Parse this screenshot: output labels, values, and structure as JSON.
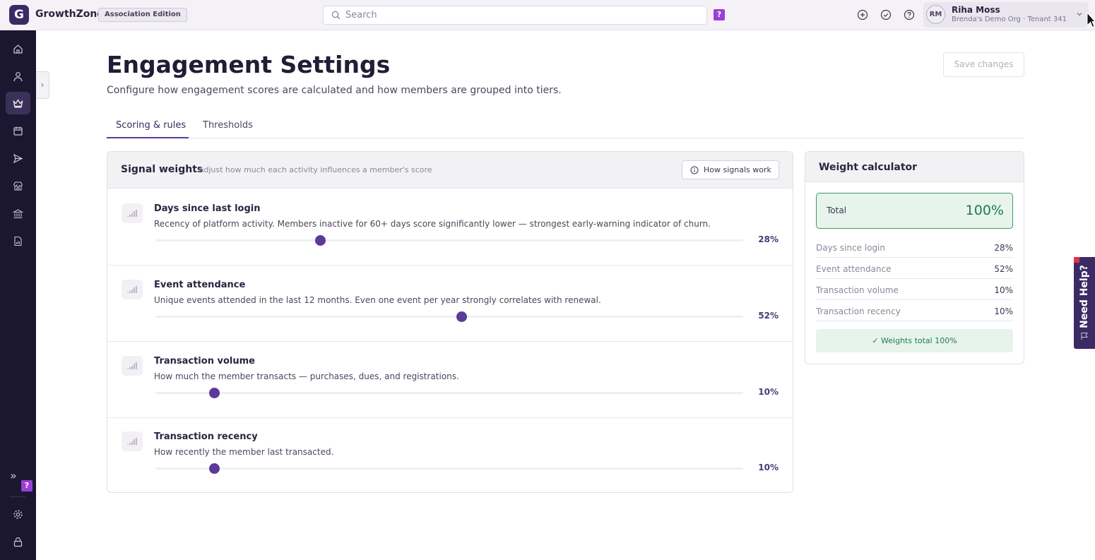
{
  "app": {
    "logo_letter": "G",
    "brand": "GrowthZone",
    "edition": "Association Edition"
  },
  "search": {
    "placeholder": "Search",
    "help_badge": "?"
  },
  "user": {
    "initials": "RM",
    "name": "Riha Moss",
    "org": "Brenda's Demo Org · Tenant 341"
  },
  "sidebar": {
    "items": [
      {
        "icon": "home-icon"
      },
      {
        "icon": "person-icon"
      },
      {
        "icon": "crown-icon",
        "active": true
      },
      {
        "icon": "calendar-icon"
      },
      {
        "icon": "send-icon"
      },
      {
        "icon": "store-icon"
      },
      {
        "icon": "bank-icon"
      },
      {
        "icon": "document-icon"
      }
    ],
    "expand_glyph": "»",
    "help_badge": "?",
    "expander_glyph": "›"
  },
  "page": {
    "title": "Engagement Settings",
    "subtitle": "Configure how engagement scores are calculated and how members are grouped into tiers.",
    "save_label": "Save changes",
    "tabs": [
      {
        "label": "Scoring & rules",
        "active": true
      },
      {
        "label": "Thresholds",
        "active": false
      }
    ]
  },
  "signal_weights": {
    "title": "Signal weights",
    "subtitle": "Adjust how much each activity influences a member's score",
    "how_label": "How signals work",
    "signals": [
      {
        "name": "Days since last login",
        "description": "Recency of platform activity. Members inactive for 60+ days score significantly lower — strongest early-warning indicator of churn.",
        "value": 28,
        "value_label": "28%"
      },
      {
        "name": "Event attendance",
        "description": "Unique events attended in the last 12 months. Even one event per year strongly correlates with renewal.",
        "value": 52,
        "value_label": "52%"
      },
      {
        "name": "Transaction volume",
        "description": "How much the member transacts — purchases, dues, and registrations.",
        "value": 10,
        "value_label": "10%"
      },
      {
        "name": "Transaction recency",
        "description": "How recently the member last transacted.",
        "value": 10,
        "value_label": "10%"
      }
    ]
  },
  "calculator": {
    "title": "Weight calculator",
    "total_label": "Total",
    "total_value": "100%",
    "rows": [
      {
        "label": "Days since login",
        "value": "28%"
      },
      {
        "label": "Event attendance",
        "value": "52%"
      },
      {
        "label": "Transaction volume",
        "value": "10%"
      },
      {
        "label": "Transaction recency",
        "value": "10%"
      }
    ],
    "status": "✓ Weights total 100%"
  },
  "help_tab": {
    "label": "Need Help?"
  },
  "colors": {
    "accent": "#5b3a9a",
    "sidebar": "#1c1730",
    "success": "#237a4e"
  }
}
